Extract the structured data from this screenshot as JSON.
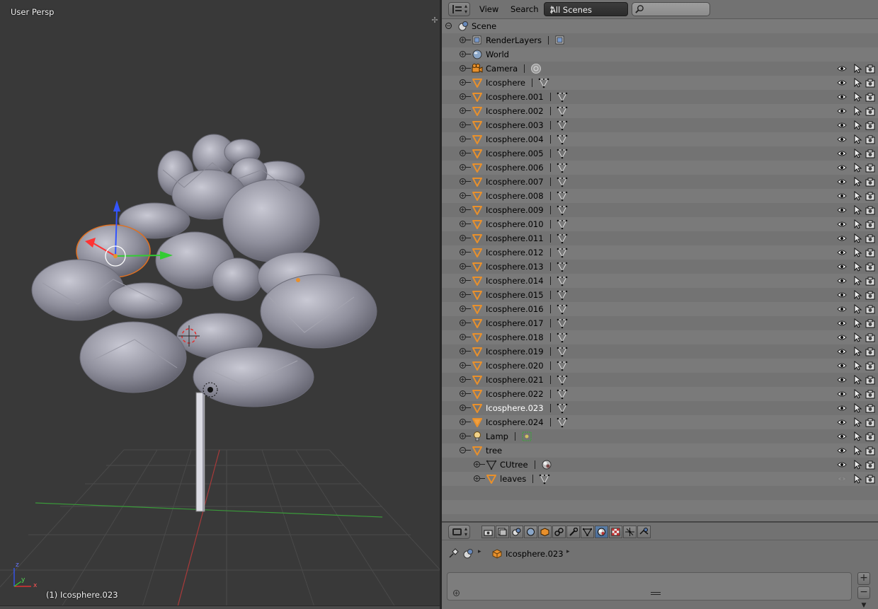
{
  "viewport": {
    "title": "User Persp",
    "object_label": "(1) Icosphere.023",
    "axis_labels": {
      "x": "x",
      "y": "y",
      "z": "z"
    }
  },
  "outliner_header": {
    "view_menu": "View",
    "search_menu": "Search",
    "scene_filter": "All Scenes",
    "search_value": ""
  },
  "outliner": {
    "rows": [
      {
        "label": "Scene",
        "type": "scene",
        "level": 0,
        "expanded": true
      },
      {
        "label": "RenderLayers",
        "type": "renderlayers",
        "level": 1,
        "sub": "renderlayers"
      },
      {
        "label": "World",
        "type": "world",
        "level": 1
      },
      {
        "label": "Camera",
        "type": "camera",
        "level": 1,
        "sub": "camera-data",
        "toggles": true
      },
      {
        "label": "Icosphere",
        "type": "mesh",
        "level": 1,
        "sub": "mesh-data",
        "toggles": true
      },
      {
        "label": "Icosphere.001",
        "type": "mesh",
        "level": 1,
        "sub": "mesh-data",
        "toggles": true
      },
      {
        "label": "Icosphere.002",
        "type": "mesh",
        "level": 1,
        "sub": "mesh-data",
        "toggles": true
      },
      {
        "label": "Icosphere.003",
        "type": "mesh",
        "level": 1,
        "sub": "mesh-data",
        "toggles": true
      },
      {
        "label": "Icosphere.004",
        "type": "mesh",
        "level": 1,
        "sub": "mesh-data",
        "toggles": true
      },
      {
        "label": "Icosphere.005",
        "type": "mesh",
        "level": 1,
        "sub": "mesh-data",
        "toggles": true
      },
      {
        "label": "Icosphere.006",
        "type": "mesh",
        "level": 1,
        "sub": "mesh-data",
        "toggles": true
      },
      {
        "label": "Icosphere.007",
        "type": "mesh",
        "level": 1,
        "sub": "mesh-data",
        "toggles": true
      },
      {
        "label": "Icosphere.008",
        "type": "mesh",
        "level": 1,
        "sub": "mesh-data",
        "toggles": true
      },
      {
        "label": "Icosphere.009",
        "type": "mesh",
        "level": 1,
        "sub": "mesh-data",
        "toggles": true
      },
      {
        "label": "Icosphere.010",
        "type": "mesh",
        "level": 1,
        "sub": "mesh-data",
        "toggles": true
      },
      {
        "label": "Icosphere.011",
        "type": "mesh",
        "level": 1,
        "sub": "mesh-data",
        "toggles": true
      },
      {
        "label": "Icosphere.012",
        "type": "mesh",
        "level": 1,
        "sub": "mesh-data",
        "toggles": true
      },
      {
        "label": "Icosphere.013",
        "type": "mesh",
        "level": 1,
        "sub": "mesh-data",
        "toggles": true
      },
      {
        "label": "Icosphere.014",
        "type": "mesh",
        "level": 1,
        "sub": "mesh-data",
        "toggles": true
      },
      {
        "label": "Icosphere.015",
        "type": "mesh",
        "level": 1,
        "sub": "mesh-data",
        "toggles": true
      },
      {
        "label": "Icosphere.016",
        "type": "mesh",
        "level": 1,
        "sub": "mesh-data",
        "toggles": true
      },
      {
        "label": "Icosphere.017",
        "type": "mesh",
        "level": 1,
        "sub": "mesh-data",
        "toggles": true
      },
      {
        "label": "Icosphere.018",
        "type": "mesh",
        "level": 1,
        "sub": "mesh-data",
        "toggles": true
      },
      {
        "label": "Icosphere.019",
        "type": "mesh",
        "level": 1,
        "sub": "mesh-data",
        "toggles": true
      },
      {
        "label": "Icosphere.020",
        "type": "mesh",
        "level": 1,
        "sub": "mesh-data",
        "toggles": true
      },
      {
        "label": "Icosphere.021",
        "type": "mesh",
        "level": 1,
        "sub": "mesh-data",
        "toggles": true
      },
      {
        "label": "Icosphere.022",
        "type": "mesh",
        "level": 1,
        "sub": "mesh-data",
        "toggles": true
      },
      {
        "label": "Icosphere.023",
        "type": "mesh",
        "level": 1,
        "sub": "mesh-data",
        "toggles": true,
        "selected": true
      },
      {
        "label": "Icosphere.024",
        "type": "mesh",
        "level": 1,
        "sub": "mesh-data",
        "toggles": true,
        "highlight": true
      },
      {
        "label": "Lamp",
        "type": "lamp",
        "level": 1,
        "sub": "lamp-data",
        "toggles": true
      },
      {
        "label": "tree",
        "type": "mesh",
        "level": 1,
        "expanded": true,
        "toggles": true
      },
      {
        "label": "CUtree",
        "type": "curve",
        "level": 2,
        "sub": "material",
        "toggles": true
      },
      {
        "label": "leaves",
        "type": "mesh",
        "level": 2,
        "sub": "mesh-data",
        "toggles": true,
        "eye_dim": true
      }
    ],
    "empty_rows": 3
  },
  "properties": {
    "active_tab": 8,
    "tabs": [
      "render-icon",
      "render-layers-icon",
      "scene-icon",
      "world-icon",
      "object-icon",
      "constraints-icon",
      "modifiers-icon",
      "data-icon",
      "material-icon",
      "texture-icon",
      "particles-icon",
      "physics-icon"
    ],
    "breadcrumb_object": "Icosphere.023",
    "add_label": "+",
    "remove_label": "−"
  },
  "colors": {
    "viewport_bg": "#393939",
    "outliner_bg": "#757575",
    "selected_text": "#ffffff",
    "mesh_icon": "#e8902c",
    "axis_x": "#ff3333",
    "axis_y": "#33cc33",
    "axis_z": "#3355ff"
  }
}
